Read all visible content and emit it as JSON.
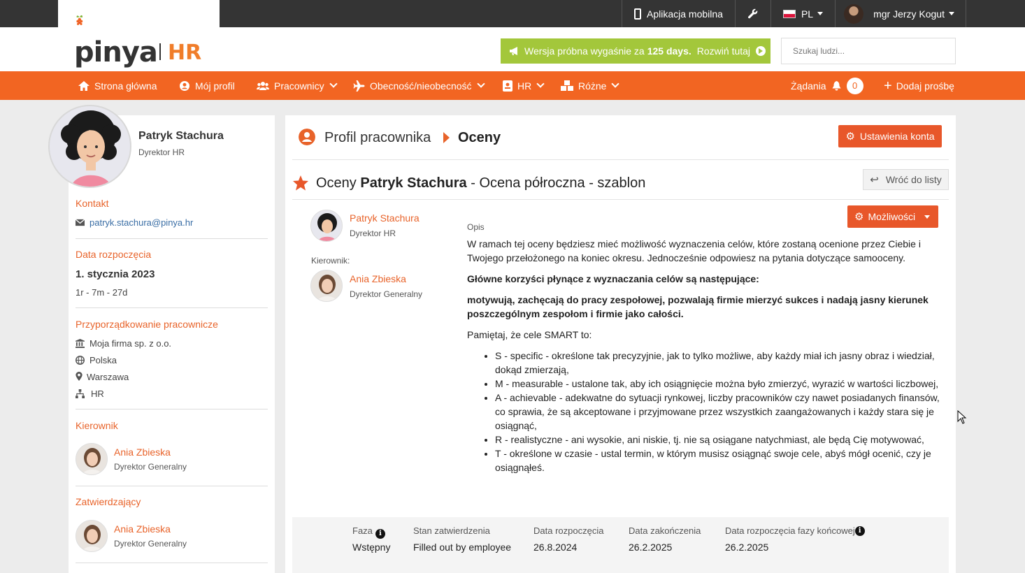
{
  "topbar": {
    "mobile_app": "Aplikacja mobilna",
    "lang": "PL",
    "user": "mgr Jerzy Kogut"
  },
  "header": {
    "logo_text": "pinya",
    "logo_hr": "HR",
    "trial_prefix": "Wersja próbna wygaśnie za",
    "trial_days": "125 days.",
    "trial_link": "Rozwiń tutaj",
    "search_placeholder": "Szukaj ludzi..."
  },
  "nav": {
    "home": "Strona główna",
    "my_profile": "Mój profil",
    "employees": "Pracownicy",
    "attendance": "Obecność/nieobecność",
    "hr": "HR",
    "misc": "Różne",
    "requests": "Żądania",
    "requests_count": "0",
    "add_request": "Dodaj prośbę"
  },
  "left": {
    "name": "Patryk Stachura",
    "role": "Dyrektor HR",
    "contact_title": "Kontakt",
    "email": "patryk.stachura@pinya.hr",
    "start_title": "Data rozpoczęcia",
    "start_date": "1. stycznia 2023",
    "tenure": "1r - 7m - 27d",
    "assign_title": "Przyporządkowanie pracownicze",
    "company": "Moja firma sp. z o.o.",
    "country": "Polska",
    "city": "Warszawa",
    "department": "HR",
    "manager_title": "Kierownik",
    "manager_name": "Ania Zbieska",
    "manager_role": "Dyrektor Generalny",
    "approver_title": "Zatwierdzający",
    "approver_name": "Ania Zbieska",
    "approver_role": "Dyrektor Generalny"
  },
  "main": {
    "crumb_profile": "Profil pracownika",
    "crumb_current": "Oceny",
    "account_settings": "Ustawienia konta",
    "title_prefix": "Oceny",
    "title_name": "Patryk Stachura",
    "title_suffix": "- Ocena półroczna - szablon",
    "back": "Wróć do listy",
    "options": "Możliwości",
    "employee_name": "Patryk Stachura",
    "employee_role": "Dyrektor HR",
    "manager_label": "Kierownik:",
    "manager_name": "Ania Zbieska",
    "manager_role": "Dyrektor Generalny",
    "desc_label": "Opis",
    "desc_p1": "W ramach tej oceny będziesz mieć możliwość wyznaczenia celów, które zostaną ocenione przez Ciebie i Twojego przełożonego na koniec okresu. Jednocześnie odpowiesz na pytania dotyczące samooceny.",
    "desc_p2": "Główne korzyści płynące z wyznaczania celów są następujące:",
    "desc_p3": "motywują, zachęcają do pracy zespołowej, pozwalają firmie mierzyć sukces i nadają jasny kierunek poszczególnym zespołom i firmie jako całości.",
    "desc_p4": "Pamiętaj, że cele SMART to:",
    "smart": [
      "S - specific - określone tak precyzyjnie, jak to tylko możliwe, aby każdy miał ich jasny obraz i wiedział, dokąd zmierzają,",
      "M - measurable - ustalone tak, aby ich osiągnięcie można było zmierzyć, wyrazić w wartości liczbowej,",
      "A - achievable - adekwatne do sytuacji rynkowej, liczby pracowników czy nawet posiadanych finansów, co sprawia, że są akceptowane i przyjmowane przez wszystkich zaangażowanych i każdy stara się je osiągnąć,",
      "R - realistyczne - ani wysokie, ani niskie, tj. nie są osiągane natychmiast, ale będą Cię motywować,",
      "T - określone w czasie - ustal termin, w którym musisz osiągnąć swoje cele, abyś mógł ocenić, czy je osiągnąłeś."
    ]
  },
  "footer": {
    "phase_label": "Faza",
    "phase_value": "Wstępny",
    "status_label": "Stan zatwierdzenia",
    "status_value": "Filled out by employee",
    "start_label": "Data rozpoczęcia",
    "start_value": "26.8.2024",
    "end_label": "Data zakończenia",
    "end_value": "26.2.2025",
    "final_label": "Data rozpoczęcia fazy końcowej",
    "final_value": "26.2.2025"
  },
  "colors": {
    "brand_orange": "#f26522",
    "trial_green": "#a3c73b",
    "topbar_dark": "#343434"
  }
}
